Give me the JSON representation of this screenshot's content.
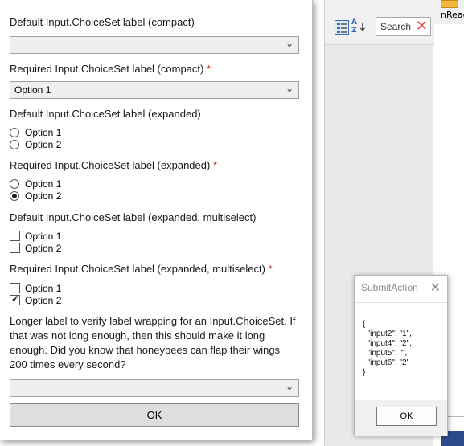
{
  "background": {
    "read_label": "nRead",
    "search_placeholder": "Search"
  },
  "card": {
    "fields": [
      {
        "label": "Default Input.ChoiceSet label (compact)",
        "required": false,
        "value": ""
      },
      {
        "label": "Required Input.ChoiceSet label (compact) ",
        "required": true,
        "value": "Option 1"
      },
      {
        "label": "Default Input.ChoiceSet label (expanded)",
        "required": false,
        "options": [
          "Option 1",
          "Option 2"
        ],
        "selected": []
      },
      {
        "label": "Required Input.ChoiceSet label (expanded) ",
        "required": true,
        "options": [
          "Option 1",
          "Option 2"
        ],
        "selected": [
          "Option 2"
        ]
      },
      {
        "label": "Default Input.ChoiceSet label (expanded, multiselect)",
        "required": false,
        "options": [
          "Option 1",
          "Option 2"
        ],
        "selected": []
      },
      {
        "label": "Required Input.ChoiceSet label (expanded, multiselect) ",
        "required": true,
        "options": [
          "Option 1",
          "Option 2"
        ],
        "selected": [
          "Option 2"
        ]
      }
    ],
    "required_marker": "*",
    "wrap_label": "Longer label to verify label wrapping for an Input.ChoiceSet. If that was not long enough, then this should make it long enough. Did you know that honeybees can flap their wings 200 times every second?",
    "wrap_value": "",
    "ok_label": "OK",
    "chevron": "⌄"
  },
  "submit": {
    "title": "SubmitAction",
    "close": "✕",
    "json_lines": [
      "{",
      "  \"input2\": \"1\",",
      "  \"input4\": \"2\",",
      "  \"input5\": \"\",",
      "  \"input6\": \"2\"",
      "}"
    ],
    "ok_label": "OK"
  }
}
